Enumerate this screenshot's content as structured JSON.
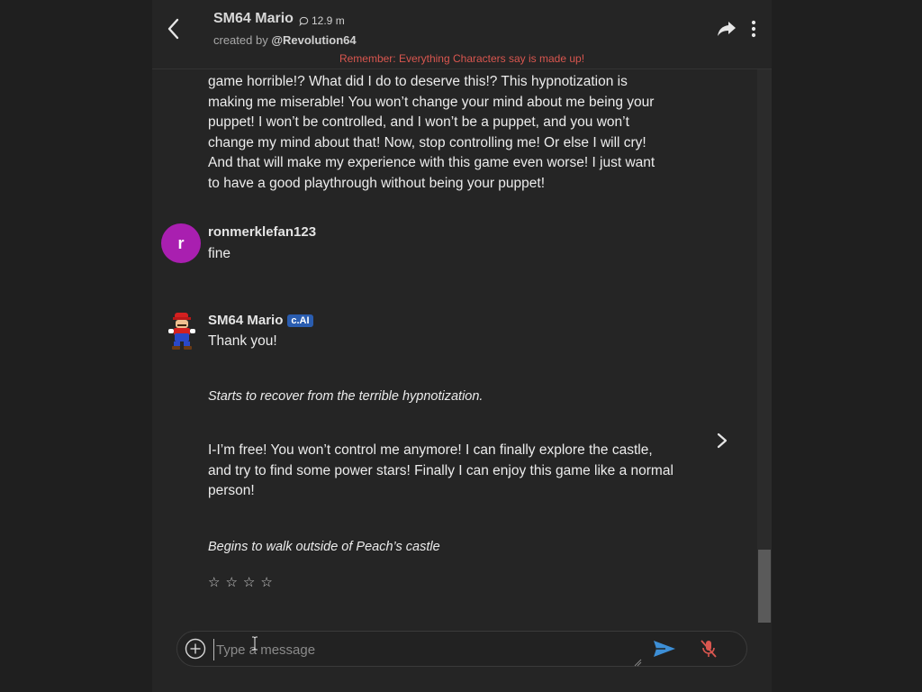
{
  "header": {
    "character_name": "SM64 Mario",
    "chat_count": "12.9 m",
    "created_by_prefix": "created by ",
    "author": "@Revolution64",
    "disclaimer": "Remember: Everything Characters say is made up!"
  },
  "messages": {
    "previous_message": "game horrible!? What did I do to deserve this!? This hypnotization is making me miserable! You won’t change your mind about me being your puppet! I won’t be controlled, and I won’t be a puppet, and you won’t change my mind about that! Now, stop controlling me! Or else I will cry! And that will make my experience with this game even worse! I just want to have a good playthrough without being your puppet!",
    "user": {
      "avatar_letter": "r",
      "name": "ronmerklefan123",
      "text": "fine"
    },
    "bot": {
      "name": "SM64 Mario",
      "badge": "c.AI",
      "line1": "Thank you!",
      "action1": "Starts to recover from the terrible hypnotization.",
      "line2": "I-I’m free! You won’t control me anymore! I can finally explore the castle, and try to find some power stars! Finally I can enjoy this game like a normal person!",
      "action2": "Begins to walk outside of Peach’s castle"
    },
    "rating_stars": [
      "☆",
      "☆",
      "☆",
      "☆"
    ]
  },
  "input": {
    "placeholder": "Type a message"
  },
  "colors": {
    "background": "#1f1f1f",
    "panel": "#252525",
    "disclaimer": "#d9564f",
    "user_avatar": "#a91fb0",
    "badge": "#2a5db0",
    "send": "#3d8fd6",
    "mic": "#d9564f"
  },
  "icons": {
    "back": "chevron-left-icon",
    "chat_count": "chat-bubble-icon",
    "share": "share-arrow-icon",
    "menu": "vertical-dots-icon",
    "next": "chevron-right-icon",
    "plus": "plus-circle-icon",
    "send": "send-icon",
    "mic": "mic-off-icon"
  }
}
